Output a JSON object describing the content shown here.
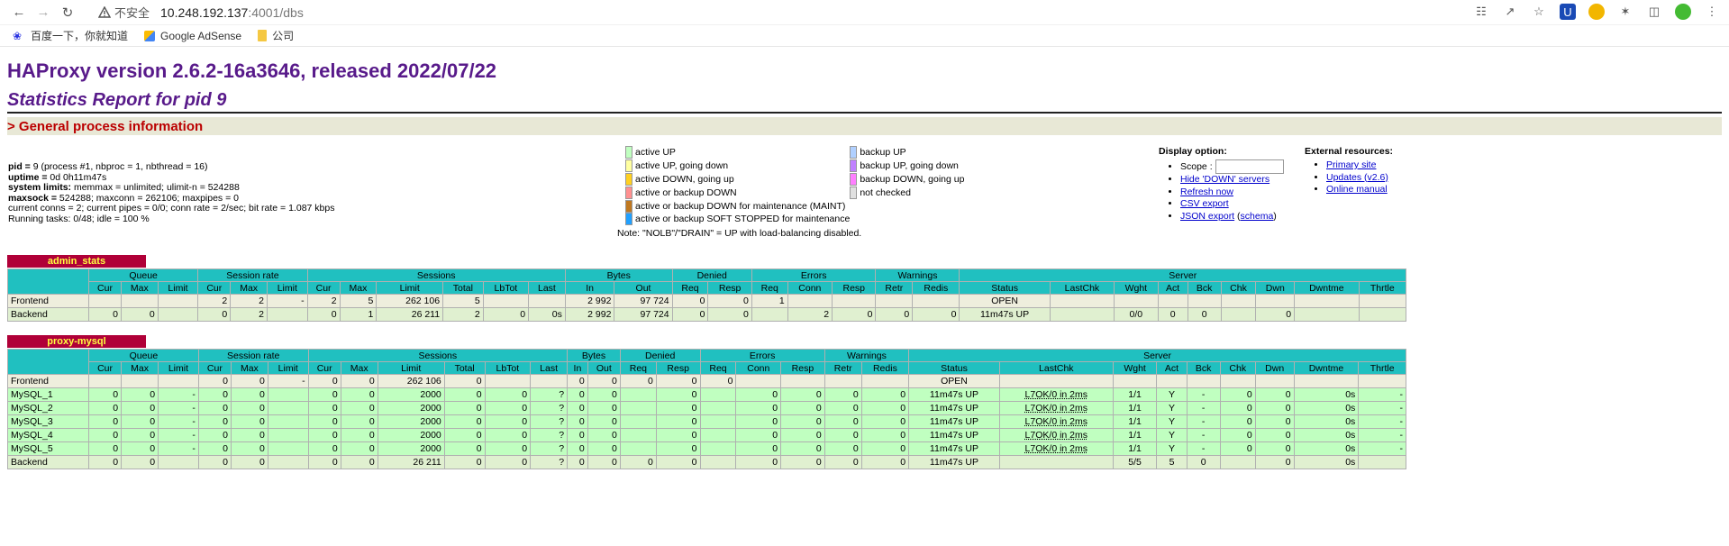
{
  "browser": {
    "security_label": "不安全",
    "url_host": "10.248.192.137",
    "url_rest": ":4001/dbs",
    "bookmarks": [
      "百度一下，你就知道",
      "Google AdSense",
      "公司"
    ]
  },
  "header": {
    "version_title": "HAProxy version 2.6.2-16a3646, released 2022/07/22",
    "report_title": "Statistics Report for pid 9",
    "section_title": "> General process information"
  },
  "process_info": [
    {
      "k": "pid = ",
      "v": "9 (process #1, nbproc = 1, nbthread = 16)"
    },
    {
      "k": "uptime = ",
      "v": "0d 0h11m47s"
    },
    {
      "k": "system limits: ",
      "v": "memmax = unlimited; ulimit-n = 524288"
    },
    {
      "k": "maxsock = ",
      "v": "524288; maxconn = 262106; maxpipes = 0"
    },
    {
      "k": "",
      "v": "current conns = 2; current pipes = 0/0; conn rate = 2/sec; bit rate = 1.087 kbps"
    },
    {
      "k": "",
      "v": "Running tasks: 0/48; idle = 100 %"
    }
  ],
  "legend": {
    "left": [
      {
        "label": "active UP",
        "color": "#c0ffc0"
      },
      {
        "label": "active UP, going down",
        "color": "#ffffa0"
      },
      {
        "label": "active DOWN, going up",
        "color": "#ffd020"
      },
      {
        "label": "active or backup DOWN",
        "color": "#ff9090"
      },
      {
        "label": "active or backup DOWN for maintenance (MAINT)",
        "color": "#c07820"
      },
      {
        "label": "active or backup SOFT STOPPED for maintenance",
        "color": "#20a0ff"
      }
    ],
    "right": [
      {
        "label": "backup UP",
        "color": "#b0d0ff"
      },
      {
        "label": "backup UP, going down",
        "color": "#c080ff"
      },
      {
        "label": "backup DOWN, going up",
        "color": "#ff80ff"
      },
      {
        "label": "not checked",
        "color": "#e0e0e0"
      }
    ],
    "note": "Note: \"NOLB\"/\"DRAIN\" = UP with load-balancing disabled."
  },
  "display": {
    "title": "Display option:",
    "scope_label": "Scope :",
    "links": [
      "Hide 'DOWN' servers",
      "Refresh now",
      "CSV export"
    ],
    "json_export": "JSON export",
    "schema": "schema"
  },
  "external": {
    "title": "External resources:",
    "links": [
      "Primary site",
      "Updates (v2.6)",
      "Online manual"
    ]
  },
  "proxies": [
    {
      "name": "admin_stats",
      "groups": [
        "Queue",
        "Session rate",
        "Sessions",
        "Bytes",
        "Denied",
        "Errors",
        "Warnings",
        "Server"
      ],
      "rows": [
        {
          "type": "fe",
          "cells": [
            "Frontend",
            "",
            "",
            "",
            "2",
            "2",
            "-",
            "2",
            "5",
            "262 106",
            "5",
            "",
            "",
            "2 992",
            "97 724",
            "0",
            "0",
            "1",
            "",
            "",
            "",
            "",
            "OPEN",
            "",
            "",
            "",
            "",
            "",
            "",
            "",
            ""
          ]
        },
        {
          "type": "be",
          "cells": [
            "Backend",
            "0",
            "0",
            "",
            "0",
            "2",
            "",
            "0",
            "1",
            "26 211",
            "2",
            "0",
            "0s",
            "2 992",
            "97 724",
            "0",
            "0",
            "",
            "2",
            "0",
            "0",
            "0",
            "11m47s UP",
            "",
            "0/0",
            "0",
            "0",
            "",
            "0",
            "",
            ""
          ]
        }
      ]
    },
    {
      "name": "proxy-mysql",
      "groups": [
        "Queue",
        "Session rate",
        "Sessions",
        "Bytes",
        "Denied",
        "Errors",
        "Warnings",
        "Server"
      ],
      "rows": [
        {
          "type": "fe",
          "cells": [
            "Frontend",
            "",
            "",
            "",
            "0",
            "0",
            "-",
            "0",
            "0",
            "262 106",
            "0",
            "",
            "",
            "0",
            "0",
            "0",
            "0",
            "0",
            "",
            "",
            "",
            "",
            "OPEN",
            "",
            "",
            "",
            "",
            "",
            "",
            "",
            ""
          ]
        },
        {
          "type": "up",
          "cells": [
            "MySQL_1",
            "0",
            "0",
            "-",
            "0",
            "0",
            "",
            "0",
            "0",
            "2000",
            "0",
            "0",
            "?",
            "0",
            "0",
            "",
            "0",
            "",
            "0",
            "0",
            "0",
            "0",
            "11m47s UP",
            "L7OK/0 in 2ms",
            "1/1",
            "Y",
            "-",
            "0",
            "0",
            "0s",
            "-"
          ]
        },
        {
          "type": "up",
          "cells": [
            "MySQL_2",
            "0",
            "0",
            "-",
            "0",
            "0",
            "",
            "0",
            "0",
            "2000",
            "0",
            "0",
            "?",
            "0",
            "0",
            "",
            "0",
            "",
            "0",
            "0",
            "0",
            "0",
            "11m47s UP",
            "L7OK/0 in 2ms",
            "1/1",
            "Y",
            "-",
            "0",
            "0",
            "0s",
            "-"
          ]
        },
        {
          "type": "up",
          "cells": [
            "MySQL_3",
            "0",
            "0",
            "-",
            "0",
            "0",
            "",
            "0",
            "0",
            "2000",
            "0",
            "0",
            "?",
            "0",
            "0",
            "",
            "0",
            "",
            "0",
            "0",
            "0",
            "0",
            "11m47s UP",
            "L7OK/0 in 2ms",
            "1/1",
            "Y",
            "-",
            "0",
            "0",
            "0s",
            "-"
          ]
        },
        {
          "type": "up",
          "cells": [
            "MySQL_4",
            "0",
            "0",
            "-",
            "0",
            "0",
            "",
            "0",
            "0",
            "2000",
            "0",
            "0",
            "?",
            "0",
            "0",
            "",
            "0",
            "",
            "0",
            "0",
            "0",
            "0",
            "11m47s UP",
            "L7OK/0 in 2ms",
            "1/1",
            "Y",
            "-",
            "0",
            "0",
            "0s",
            "-"
          ]
        },
        {
          "type": "up",
          "cells": [
            "MySQL_5",
            "0",
            "0",
            "-",
            "0",
            "0",
            "",
            "0",
            "0",
            "2000",
            "0",
            "0",
            "?",
            "0",
            "0",
            "",
            "0",
            "",
            "0",
            "0",
            "0",
            "0",
            "11m47s UP",
            "L7OK/0 in 2ms",
            "1/1",
            "Y",
            "-",
            "0",
            "0",
            "0s",
            "-"
          ]
        },
        {
          "type": "be",
          "cells": [
            "Backend",
            "0",
            "0",
            "",
            "0",
            "0",
            "",
            "0",
            "0",
            "26 211",
            "0",
            "0",
            "?",
            "0",
            "0",
            "0",
            "0",
            "",
            "0",
            "0",
            "0",
            "0",
            "11m47s UP",
            "",
            "5/5",
            "5",
            "0",
            "",
            "0",
            "0s",
            ""
          ]
        }
      ]
    }
  ],
  "columns": [
    "",
    "Cur",
    "Max",
    "Limit",
    "Cur",
    "Max",
    "Limit",
    "Cur",
    "Max",
    "Limit",
    "Total",
    "LbTot",
    "Last",
    "In",
    "Out",
    "Req",
    "Resp",
    "Req",
    "Conn",
    "Resp",
    "Retr",
    "Redis",
    "Status",
    "LastChk",
    "Wght",
    "Act",
    "Bck",
    "Chk",
    "Dwn",
    "Dwntme",
    "Thrtle"
  ]
}
